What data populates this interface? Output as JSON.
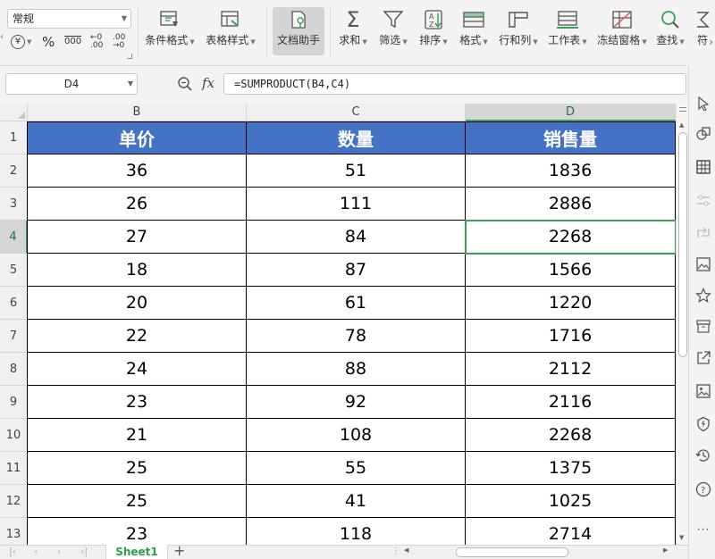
{
  "ribbon": {
    "number_format": "常规",
    "currency_symbol": "¥",
    "percent_symbol": "%",
    "thousands_label": "000",
    "inc_decimal_label": "←0 .00",
    "dec_decimal_label": ".00 →0",
    "tools": [
      {
        "name": "conditional-format",
        "label": "条件格式",
        "icon": "conditional-format-icon"
      },
      {
        "name": "table-style",
        "label": "表格样式",
        "icon": "table-style-icon"
      },
      {
        "name": "doc-assistant",
        "label": "文档助手",
        "icon": "doc-assistant-icon"
      },
      {
        "name": "sum",
        "label": "求和",
        "icon": "sum-icon"
      },
      {
        "name": "filter",
        "label": "筛选",
        "icon": "filter-icon"
      },
      {
        "name": "sort",
        "label": "排序",
        "icon": "sort-icon"
      },
      {
        "name": "format",
        "label": "格式",
        "icon": "format-icon"
      },
      {
        "name": "rows-cols",
        "label": "行和列",
        "icon": "rows-cols-icon"
      },
      {
        "name": "worksheet",
        "label": "工作表",
        "icon": "worksheet-icon"
      },
      {
        "name": "freeze-panes",
        "label": "冻结窗格",
        "icon": "freeze-panes-icon"
      },
      {
        "name": "find",
        "label": "查找",
        "icon": "find-icon"
      },
      {
        "name": "symbol",
        "label": "符",
        "icon": "symbol-icon"
      }
    ]
  },
  "formula_bar": {
    "name_box": "D4",
    "fx": "fx",
    "formula": "=SUMPRODUCT(B4,C4)"
  },
  "grid": {
    "column_headers": [
      "B",
      "C",
      "D"
    ],
    "header_row": [
      "单价",
      "数量",
      "销售量"
    ],
    "rows": [
      {
        "num": "1"
      },
      {
        "num": "2",
        "cells": [
          "36",
          "51",
          "1836"
        ]
      },
      {
        "num": "3",
        "cells": [
          "26",
          "111",
          "2886"
        ]
      },
      {
        "num": "4",
        "cells": [
          "27",
          "84",
          "2268"
        ]
      },
      {
        "num": "5",
        "cells": [
          "18",
          "87",
          "1566"
        ]
      },
      {
        "num": "6",
        "cells": [
          "20",
          "61",
          "1220"
        ]
      },
      {
        "num": "7",
        "cells": [
          "22",
          "78",
          "1716"
        ]
      },
      {
        "num": "8",
        "cells": [
          "24",
          "88",
          "2112"
        ]
      },
      {
        "num": "9",
        "cells": [
          "23",
          "92",
          "2116"
        ]
      },
      {
        "num": "10",
        "cells": [
          "21",
          "108",
          "2268"
        ]
      },
      {
        "num": "11",
        "cells": [
          "25",
          "55",
          "1375"
        ]
      },
      {
        "num": "12",
        "cells": [
          "25",
          "41",
          "1025"
        ]
      },
      {
        "num": "13",
        "cells": [
          "23",
          "118",
          "2714"
        ]
      }
    ],
    "selected_cell": "D4"
  },
  "sheets": {
    "tabs": [
      "Sheet1"
    ],
    "add_label": "+"
  },
  "colors": {
    "header_fill": "#4472c4",
    "header_text": "#ffffff",
    "selection": "#3aa055",
    "sheet_tab_text": "#2f9d47"
  },
  "sidebar": {
    "icons": [
      "select-arrow-icon",
      "shapes-icon",
      "table-grid-icon",
      "settings-sliders-icon",
      "transform-icon",
      "image-gallery-icon",
      "star-icon",
      "archive-icon",
      "share-icon",
      "picture-icon",
      "shield-icon",
      "backup-icon",
      "help-icon",
      "more-icon"
    ]
  }
}
